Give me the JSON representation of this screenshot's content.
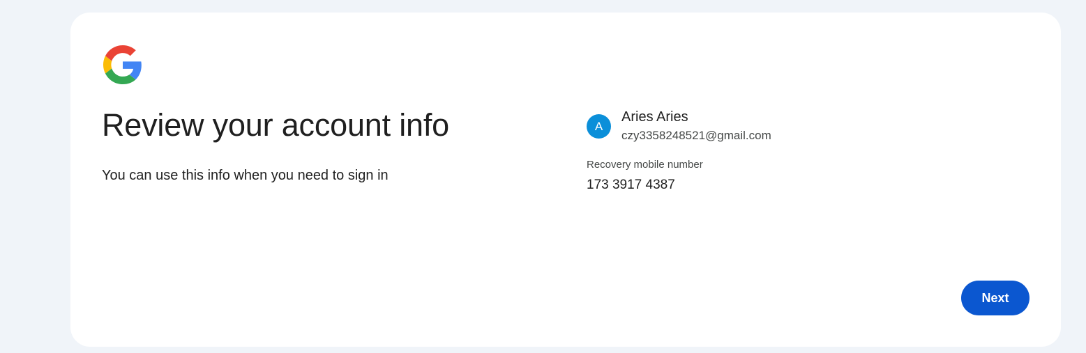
{
  "logo": {
    "icon": "google-g-logo",
    "colors": {
      "blue": "#4285F4",
      "red": "#EA4335",
      "yellow": "#FBBC05",
      "green": "#34A853"
    }
  },
  "page": {
    "title": "Review your account info",
    "subtitle": "You can use this info when you need to sign in"
  },
  "account": {
    "avatar_letter": "A",
    "avatar_color": "#0b8fd9",
    "name": "Aries Aries",
    "email": "czy3358248521@gmail.com"
  },
  "recovery": {
    "label": "Recovery mobile number",
    "value": "173 3917 4387"
  },
  "actions": {
    "next_label": "Next",
    "button_color": "#0b57d0"
  }
}
